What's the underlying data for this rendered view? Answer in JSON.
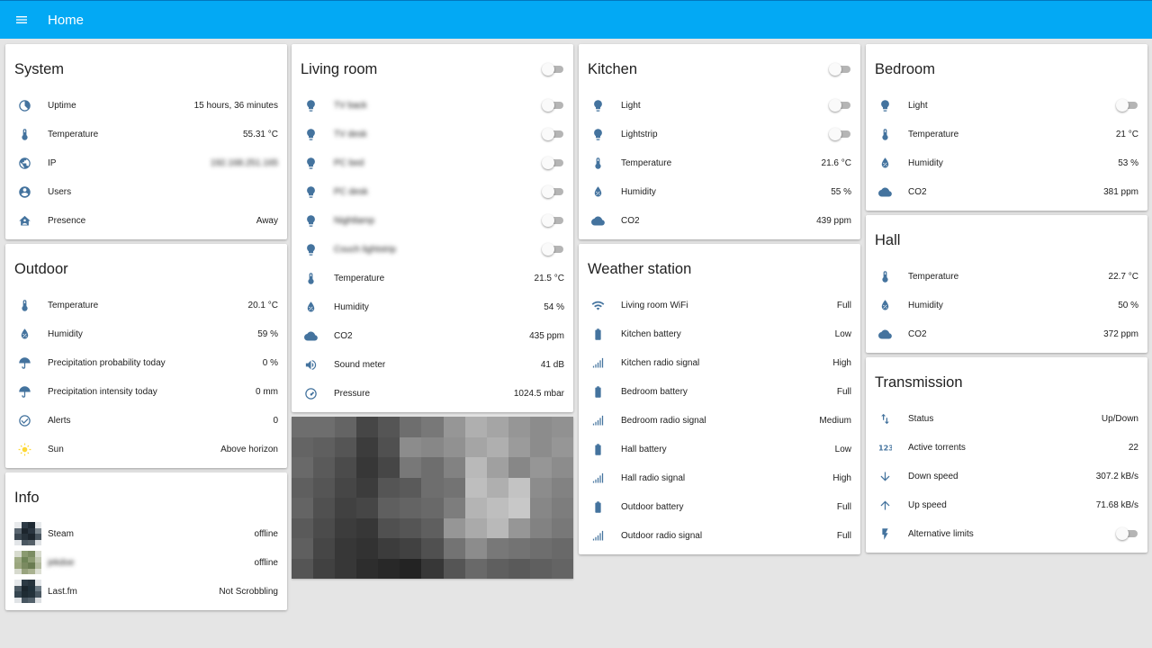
{
  "app": {
    "title": "Home"
  },
  "system": {
    "title": "System",
    "rows": [
      {
        "icon": "uptime-icon",
        "label": "Uptime",
        "value": "15 hours, 36 minutes"
      },
      {
        "icon": "thermometer-icon",
        "label": "Temperature",
        "value": "55.31 °C"
      },
      {
        "icon": "globe-icon",
        "label": "IP",
        "value": "192.168.251.165"
      },
      {
        "icon": "account-icon",
        "label": "Users",
        "value": ""
      },
      {
        "icon": "home-account-icon",
        "label": "Presence",
        "value": "Away"
      }
    ]
  },
  "outdoor": {
    "title": "Outdoor",
    "rows": [
      {
        "icon": "thermometer-icon",
        "label": "Temperature",
        "value": "20.1 °C"
      },
      {
        "icon": "water-percent-icon",
        "label": "Humidity",
        "value": "59 %"
      },
      {
        "icon": "umbrella-icon",
        "label": "Precipitation probability today",
        "value": "0 %"
      },
      {
        "icon": "umbrella-icon",
        "label": "Precipitation intensity today",
        "value": "0 mm"
      },
      {
        "icon": "check-circle-icon",
        "label": "Alerts",
        "value": "0"
      },
      {
        "icon": "sun-icon",
        "label": "Sun",
        "value": "Above horizon"
      }
    ]
  },
  "info": {
    "title": "Info",
    "rows": [
      {
        "label": "Steam",
        "value": "offline"
      },
      {
        "label": "jekdoe",
        "value": "offline"
      },
      {
        "label": "Last.fm",
        "value": "Not Scrobbling"
      }
    ]
  },
  "living_room": {
    "title": "Living room",
    "lights": [
      "TV back",
      "TV desk",
      "PC bed",
      "PC desk",
      "Nightlamp",
      "Couch lightstrip"
    ],
    "rows": [
      {
        "icon": "thermometer-icon",
        "label": "Temperature",
        "value": "21.5 °C"
      },
      {
        "icon": "water-percent-icon",
        "label": "Humidity",
        "value": "54 %"
      },
      {
        "icon": "cloud-icon",
        "label": "CO2",
        "value": "435 ppm"
      },
      {
        "icon": "volume-icon",
        "label": "Sound meter",
        "value": "41 dB"
      },
      {
        "icon": "gauge-icon",
        "label": "Pressure",
        "value": "1024.5 mbar"
      }
    ]
  },
  "kitchen": {
    "title": "Kitchen",
    "lights": [
      "Light",
      "Lightstrip"
    ],
    "rows": [
      {
        "icon": "thermometer-icon",
        "label": "Temperature",
        "value": "21.6 °C"
      },
      {
        "icon": "water-percent-icon",
        "label": "Humidity",
        "value": "55 %"
      },
      {
        "icon": "cloud-icon",
        "label": "CO2",
        "value": "439 ppm"
      }
    ]
  },
  "weather_station": {
    "title": "Weather station",
    "rows": [
      {
        "icon": "wifi-icon",
        "label": "Living room WiFi",
        "value": "Full"
      },
      {
        "icon": "battery-icon",
        "label": "Kitchen battery",
        "value": "Low"
      },
      {
        "icon": "signal-icon",
        "label": "Kitchen radio signal",
        "value": "High"
      },
      {
        "icon": "battery-icon",
        "label": "Bedroom battery",
        "value": "Full"
      },
      {
        "icon": "signal-icon",
        "label": "Bedroom radio signal",
        "value": "Medium"
      },
      {
        "icon": "battery-icon",
        "label": "Hall battery",
        "value": "Low"
      },
      {
        "icon": "signal-icon",
        "label": "Hall radio signal",
        "value": "High"
      },
      {
        "icon": "battery-icon",
        "label": "Outdoor battery",
        "value": "Full"
      },
      {
        "icon": "signal-icon",
        "label": "Outdoor radio signal",
        "value": "Full"
      }
    ]
  },
  "bedroom": {
    "title": "Bedroom",
    "light": "Light",
    "rows": [
      {
        "icon": "thermometer-icon",
        "label": "Temperature",
        "value": "21 °C"
      },
      {
        "icon": "water-percent-icon",
        "label": "Humidity",
        "value": "53 %"
      },
      {
        "icon": "cloud-icon",
        "label": "CO2",
        "value": "381 ppm"
      }
    ]
  },
  "hall": {
    "title": "Hall",
    "rows": [
      {
        "icon": "thermometer-icon",
        "label": "Temperature",
        "value": "22.7 °C"
      },
      {
        "icon": "water-percent-icon",
        "label": "Humidity",
        "value": "50 %"
      },
      {
        "icon": "cloud-icon",
        "label": "CO2",
        "value": "372 ppm"
      }
    ]
  },
  "transmission": {
    "title": "Transmission",
    "rows": [
      {
        "icon": "swap-vertical-icon",
        "label": "Status",
        "value": "Up/Down"
      },
      {
        "icon": "numeric-icon",
        "label": "Active torrents",
        "value": "22"
      },
      {
        "icon": "arrow-down-icon",
        "label": "Down speed",
        "value": "307.2 kB/s"
      },
      {
        "icon": "arrow-up-icon",
        "label": "Up speed",
        "value": "71.68 kB/s"
      }
    ],
    "alt_limits_label": "Alternative limits"
  },
  "colors": {
    "header": "#03a9f4",
    "icon": "#44739e",
    "sun": "#fdd835",
    "background": "#e5e5e5"
  }
}
